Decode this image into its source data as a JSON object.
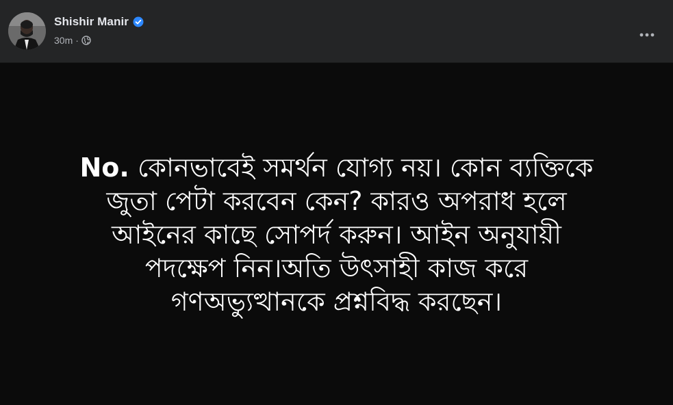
{
  "author": {
    "name": "Shishir Manir",
    "verified": true,
    "timestamp": "30m",
    "separator": "·",
    "audience_icon": "globe-icon"
  },
  "header": {
    "more_icon": "more-horizontal-icon",
    "background": "#242526"
  },
  "post": {
    "lead": "No.",
    "lines": [
      "কোনভাবেই সমর্থন যোগ্য নয়। কোন ব্যক্তিকে",
      "জুতা পেটা করবেন কেন? কারও অপরাধ হলে",
      "আইনের কাছে সোপর্দ করুন। আইন অনুযায়ী",
      "পদক্ষেপ নিন।অতি উৎসাহী কাজ করে",
      "গণঅভ্যুত্থানকে প্রশ্নবিদ্ধ করছেন।"
    ],
    "background": "#0b0b0b",
    "text_color": "#ffffff"
  },
  "colors": {
    "verified_badge": "#2d88ff",
    "name_text": "#e4e6eb",
    "meta_text": "#b0b3b8"
  }
}
